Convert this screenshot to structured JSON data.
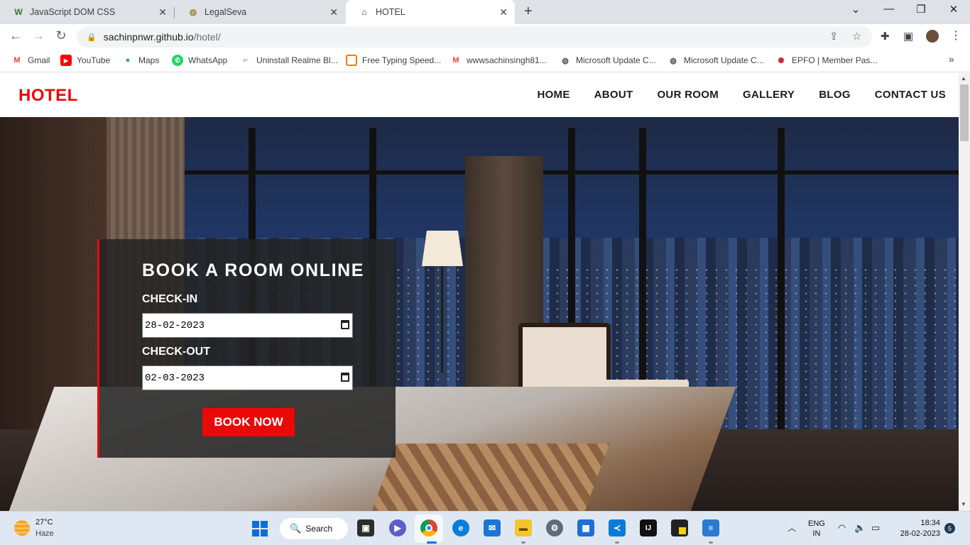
{
  "browser": {
    "tabs": [
      {
        "title": "JavaScript DOM CSS",
        "favicon": "W"
      },
      {
        "title": "LegalSeva",
        "favicon": "globe"
      },
      {
        "title": "HOTEL",
        "favicon": "hotel"
      }
    ],
    "url_host": "sachinpnwr.github.io",
    "url_path": "/hotel/",
    "bookmarks": [
      "Gmail",
      "YouTube",
      "Maps",
      "WhatsApp",
      "Uninstall Realme Bl...",
      "Free Typing Speed...",
      "wwwsachinsingh81...",
      "Microsoft Update C...",
      "Microsoft Update C...",
      "EPFO | Member Pas..."
    ]
  },
  "site": {
    "logo": "HOTEL",
    "nav": [
      "HOME",
      "ABOUT",
      "OUR ROOM",
      "GALLERY",
      "BLOG",
      "CONTACT US"
    ],
    "booking": {
      "heading": "BOOK A ROOM ONLINE",
      "checkin_label": "CHECK-IN",
      "checkin_value": "28-02-2023",
      "checkout_label": "CHECK-OUT",
      "checkout_value": "02-03-2023",
      "button": "BOOK NOW"
    },
    "accent_color": "#e30d0d"
  },
  "taskbar": {
    "weather_temp": "27°C",
    "weather_cond": "Haze",
    "search_label": "Search",
    "lang_1": "ENG",
    "lang_2": "IN",
    "time": "18:34",
    "date": "28-02-2023",
    "notifications": "5"
  }
}
